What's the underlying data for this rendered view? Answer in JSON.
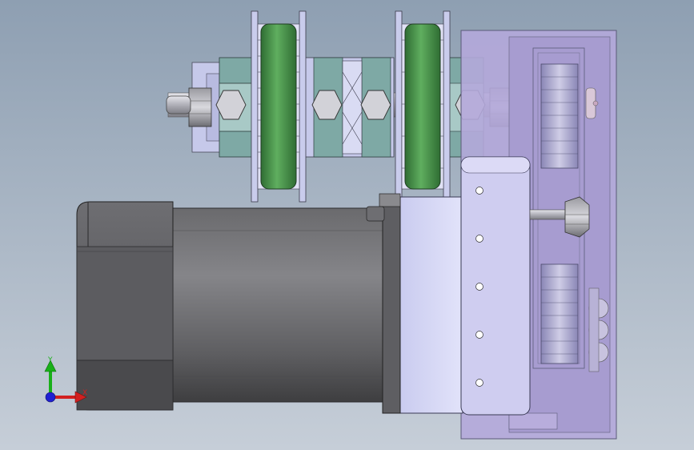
{
  "triad": {
    "y_label": "Y",
    "x_label": "X"
  },
  "colors": {
    "background_top": "#8e9fb2",
    "background_bottom": "#c4ccd6",
    "motor_dark": "#5f5f62",
    "motor_body": "#77777a",
    "steel": "#c8c8cf",
    "hex_teal": "#7da6a3",
    "roller_green": "#4f9a52",
    "gearbox": "#d6d8f6",
    "lavender_plate": "#b8addc",
    "axis_x": "#d22020",
    "axis_y": "#19b019",
    "axis_z": "#2020d2"
  }
}
